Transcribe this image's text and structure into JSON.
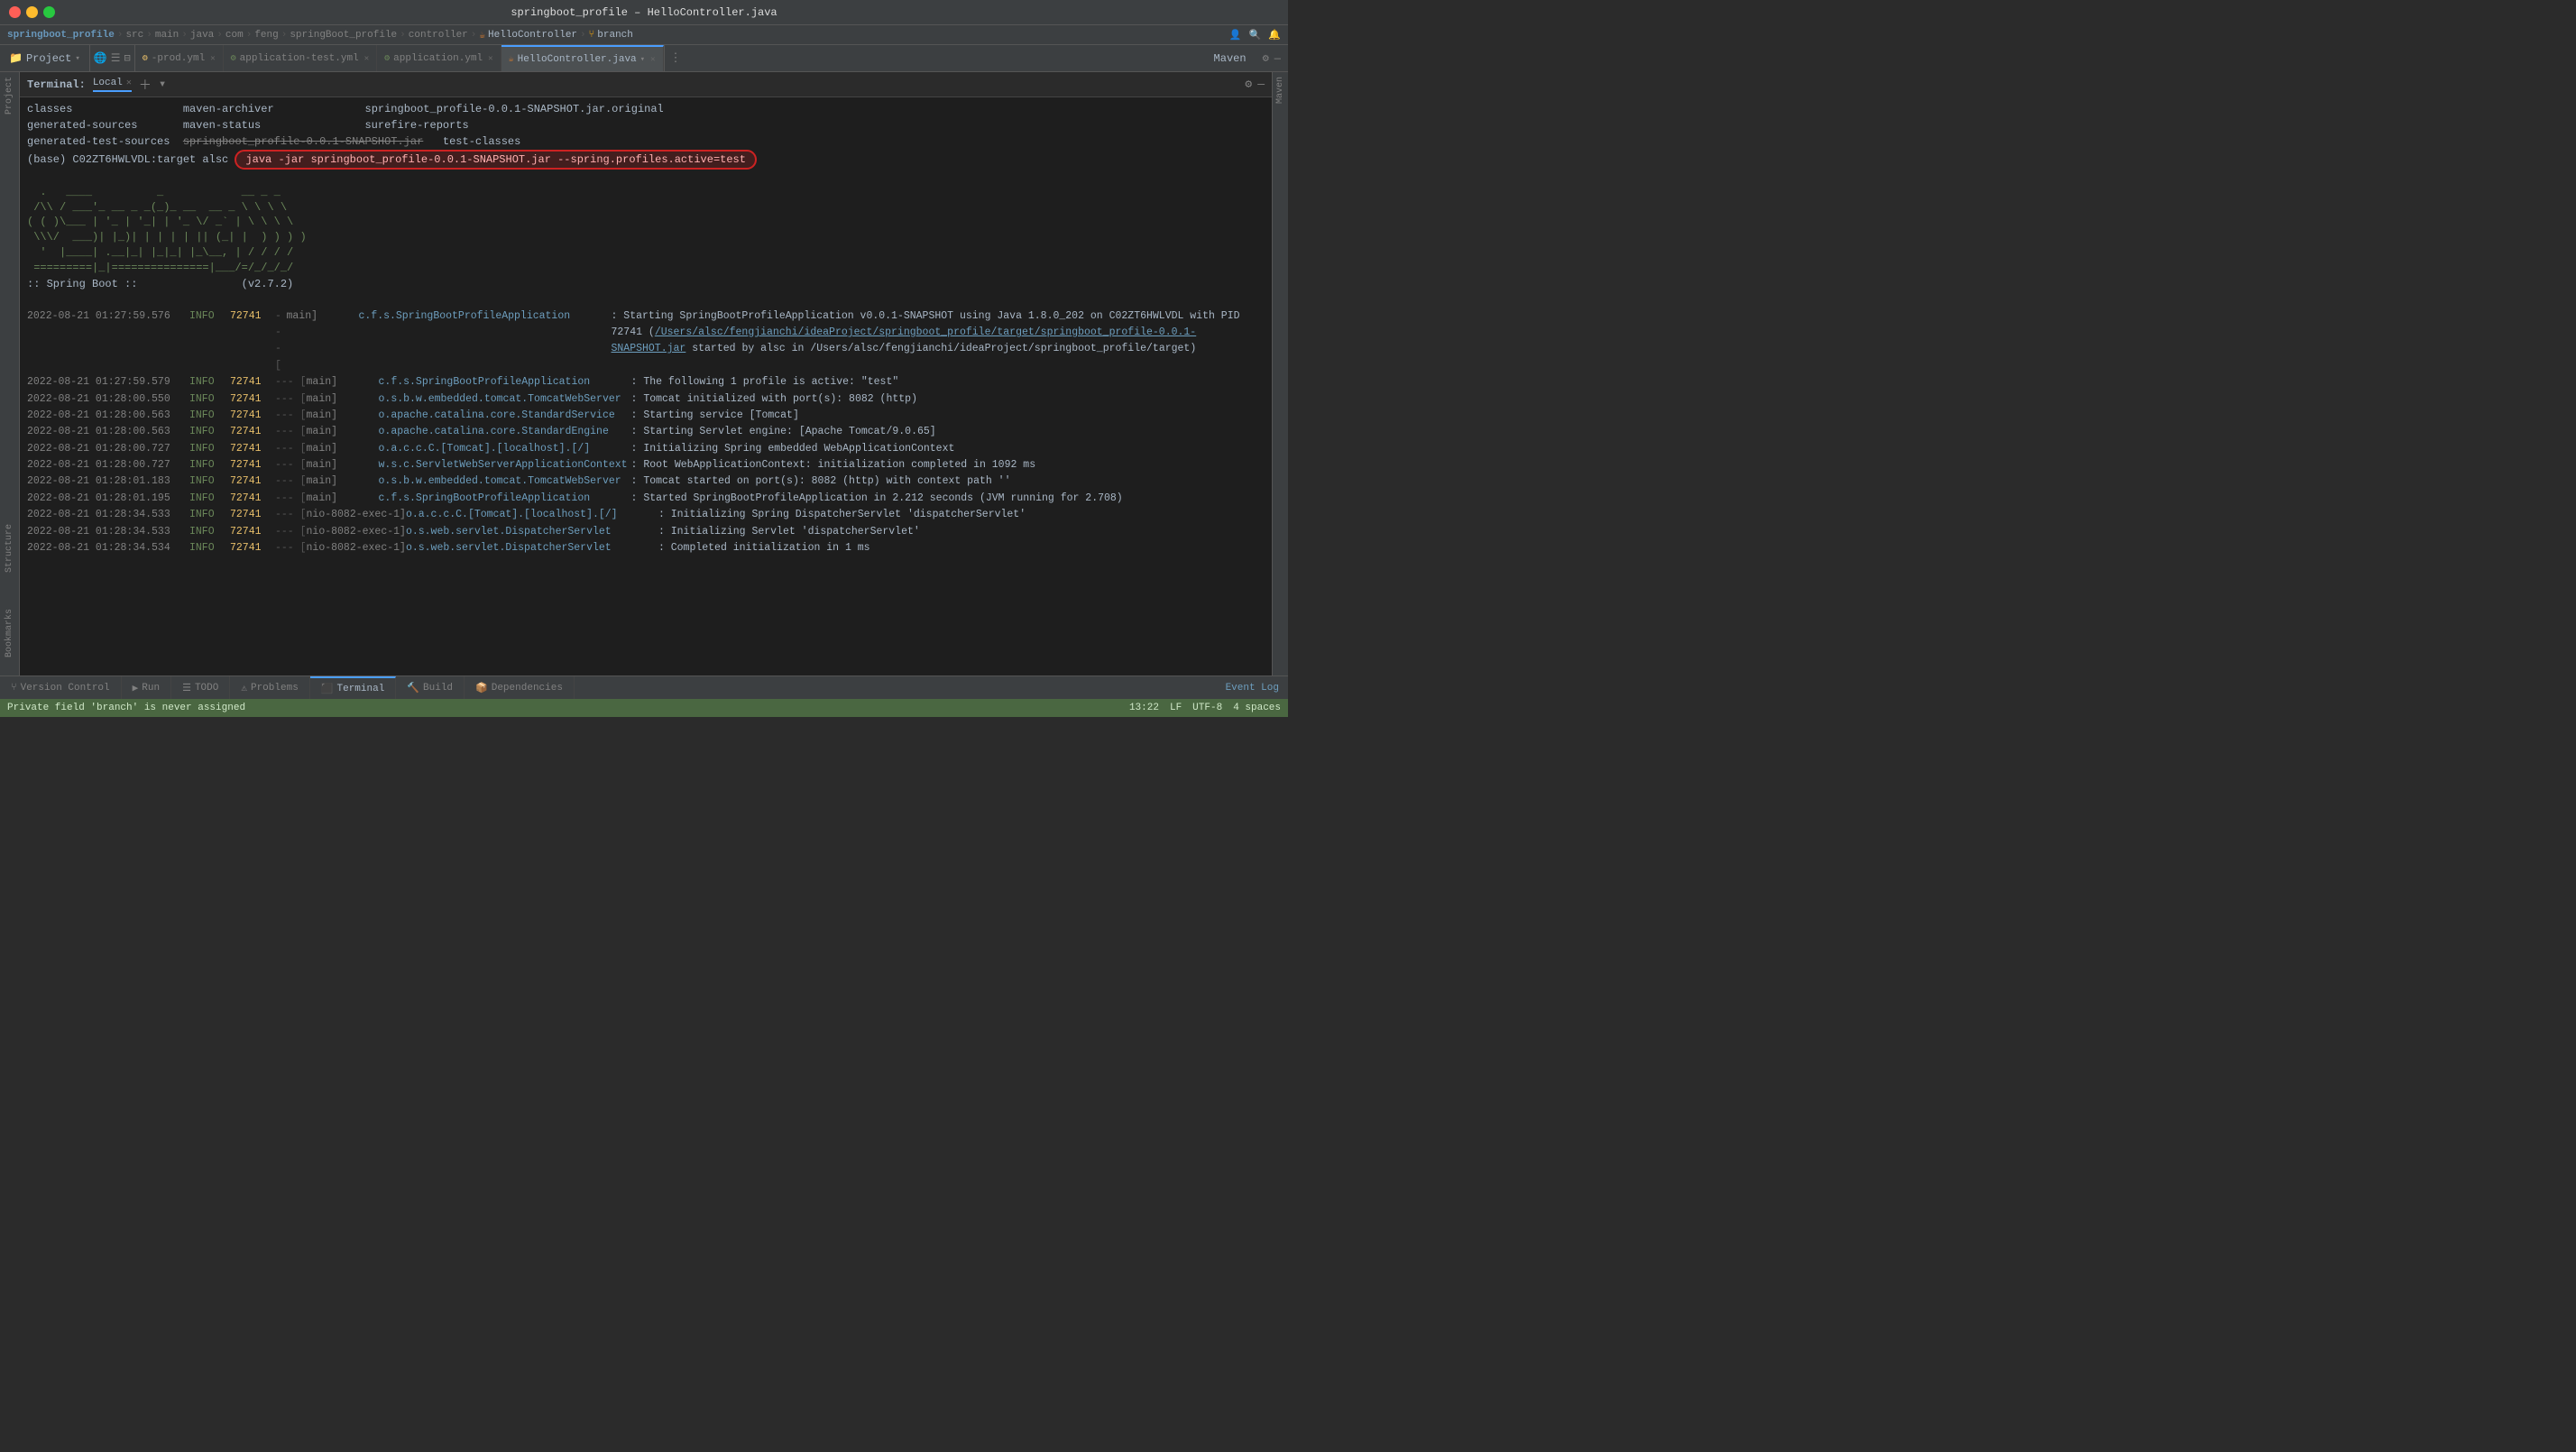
{
  "titleBar": {
    "title": "springboot_profile",
    "separator": " – ",
    "filename": "HelloController.java"
  },
  "breadcrumbs": [
    {
      "label": "springboot_profile",
      "type": "project"
    },
    {
      "label": "src",
      "type": "crumb"
    },
    {
      "label": "main",
      "type": "crumb"
    },
    {
      "label": "java",
      "type": "crumb"
    },
    {
      "label": "com",
      "type": "crumb"
    },
    {
      "label": "feng",
      "type": "crumb"
    },
    {
      "label": "springBoot_profile",
      "type": "crumb"
    },
    {
      "label": "controller",
      "type": "crumb"
    },
    {
      "label": "HelloController",
      "type": "class"
    },
    {
      "label": "branch",
      "type": "branch"
    }
  ],
  "tabs": [
    {
      "label": "-prod.yml",
      "icon": "yaml",
      "active": false,
      "closeable": true
    },
    {
      "label": "application-test.yml",
      "icon": "yaml",
      "active": false,
      "closeable": true
    },
    {
      "label": "application.yml",
      "icon": "yaml",
      "active": false,
      "closeable": true
    },
    {
      "label": "HelloController.java",
      "icon": "java",
      "active": true,
      "closeable": true
    }
  ],
  "sidebarLabel": "Project",
  "mavenLabel": "Maven",
  "terminalTab": "Local",
  "terminalOutput": {
    "dirLines": [
      {
        "col1": "classes",
        "col2": "maven-archiver",
        "col3": "springboot_profile-0.0.1-SNAPSHOT.jar.original"
      },
      {
        "col1": "generated-sources",
        "col2": "maven-status",
        "col3": "surefire-reports"
      },
      {
        "col1": "generated-test-sources",
        "col2": "springboot_profile-0.0.1-SNAPSHOT.jar",
        "col3": "test-classes"
      }
    ],
    "commandLine": "(base) C02ZT6HWLVDL:target alsc",
    "highlightedCmd": "java -jar springboot_profile-0.0.1-SNAPSHOT.jar --spring.profiles.active=test",
    "springAscii": [
      "  .   ____          _            __ _ _",
      " /\\\\ / ___'_ __ _ _(_)_ __  __ _ \\ \\ \\ \\",
      "( ( )\\___ | '_ | '_| | '_ \\/ _` | \\ \\ \\ \\",
      " \\\\/  ___)| |_)| | | | | || (_| |  ) ) ) )",
      "  '  |____| .__|_| |_|_| |_\\__, | / / / /",
      " =========|_|===============|___/=/_/_/_/"
    ],
    "springVersion": ":: Spring Boot ::                (v2.7.2)",
    "logLines": [
      {
        "date": "2022-08-21 01:27:59.576",
        "level": "INFO",
        "pid": "72741",
        "sep": "---",
        "thread": "[",
        "threadName": "           main]",
        "logger": "c.f.s.SpringBootProfileApplication",
        "msg": " : Starting SpringBootProfileApplication v0.0.1-SNAPSHOT using Java 1.8.0_202 on C02ZT6HWLVDL with PID 72741 (/Users/alsc/fengjianchi/ideaProject/springboot_profile/target/springboot_profile-0.0.1-SNAPSHOT.jar started by alsc in /Users/alsc/fengjianchi/ideaProject/springboot_profile/target)"
      },
      {
        "date": "2022-08-21 01:27:59.579",
        "level": "INFO",
        "pid": "72741",
        "sep": "---",
        "thread": "[",
        "threadName": "           main]",
        "logger": "c.f.s.SpringBootProfileApplication",
        "msg": " : The following 1 profile is active: \"test\""
      },
      {
        "date": "2022-08-21 01:28:00.550",
        "level": "INFO",
        "pid": "72741",
        "sep": "---",
        "thread": "[",
        "threadName": "           main]",
        "logger": "o.s.b.w.embedded.tomcat.TomcatWebServer",
        "msg": " : Tomcat initialized with port(s): 8082 (http)"
      },
      {
        "date": "2022-08-21 01:28:00.563",
        "level": "INFO",
        "pid": "72741",
        "sep": "---",
        "thread": "[",
        "threadName": "           main]",
        "logger": "o.apache.catalina.core.StandardService",
        "msg": " : Starting service [Tomcat]"
      },
      {
        "date": "2022-08-21 01:28:00.563",
        "level": "INFO",
        "pid": "72741",
        "sep": "---",
        "thread": "[",
        "threadName": "           main]",
        "logger": "o.apache.catalina.core.StandardEngine",
        "msg": " : Starting Servlet engine: [Apache Tomcat/9.0.65]"
      },
      {
        "date": "2022-08-21 01:28:00.727",
        "level": "INFO",
        "pid": "72741",
        "sep": "---",
        "thread": "[",
        "threadName": "           main]",
        "logger": "o.a.c.c.C.[Tomcat].[localhost].[/]",
        "msg": " : Initializing Spring embedded WebApplicationContext"
      },
      {
        "date": "2022-08-21 01:28:00.727",
        "level": "INFO",
        "pid": "72741",
        "sep": "---",
        "thread": "[",
        "threadName": "           main]",
        "logger": "w.s.c.ServletWebServerApplicationContext",
        "msg": " : Root WebApplicationContext: initialization completed in 1092 ms"
      },
      {
        "date": "2022-08-21 01:28:01.183",
        "level": "INFO",
        "pid": "72741",
        "sep": "---",
        "thread": "[",
        "threadName": "           main]",
        "logger": "o.s.b.w.embedded.tomcat.TomcatWebServer",
        "msg": " : Tomcat started on port(s): 8082 (http) with context path ''"
      },
      {
        "date": "2022-08-21 01:28:01.195",
        "level": "INFO",
        "pid": "72741",
        "sep": "---",
        "thread": "[",
        "threadName": "           main]",
        "logger": "c.f.s.SpringBootProfileApplication",
        "msg": " : Started SpringBootProfileApplication in 2.212 seconds (JVM running for 2.708)"
      },
      {
        "date": "2022-08-21 01:28:34.533",
        "level": "INFO",
        "pid": "72741",
        "sep": "---",
        "thread": "[",
        "threadName": "nio-8082-exec-1]",
        "logger": "o.a.c.c.C.[Tomcat].[localhost].[/]",
        "msg": " : Initializing Spring DispatcherServlet 'dispatcherServlet'"
      },
      {
        "date": "2022-08-21 01:28:34.533",
        "level": "INFO",
        "pid": "72741",
        "sep": "---",
        "thread": "[",
        "threadName": "nio-8082-exec-1]",
        "logger": "o.s.web.servlet.DispatcherServlet",
        "msg": " : Initializing Servlet 'dispatcherServlet'"
      },
      {
        "date": "2022-08-21 01:28:34.534",
        "level": "INFO",
        "pid": "72741",
        "sep": "---",
        "thread": "[",
        "threadName": "nio-8082-exec-1]",
        "logger": "o.s.web.servlet.DispatcherServlet",
        "msg": " : Completed initialization in 1 ms"
      }
    ]
  },
  "bottomTabs": [
    {
      "label": "Version Control",
      "icon": "git",
      "active": false
    },
    {
      "label": "Run",
      "icon": "run",
      "active": false
    },
    {
      "label": "TODO",
      "icon": "todo",
      "active": false
    },
    {
      "label": "Problems",
      "icon": "problems",
      "active": false
    },
    {
      "label": "Terminal",
      "icon": "terminal",
      "active": true
    },
    {
      "label": "Build",
      "icon": "build",
      "active": false
    },
    {
      "label": "Dependencies",
      "icon": "dep",
      "active": false
    }
  ],
  "bottomRight": {
    "time": "13:22",
    "lf": "LF",
    "encoding": "UTF-8",
    "spaces": "4 spaces"
  },
  "statusBar": {
    "warning": "Private field 'branch' is never assigned",
    "eventLog": "Event Log"
  }
}
